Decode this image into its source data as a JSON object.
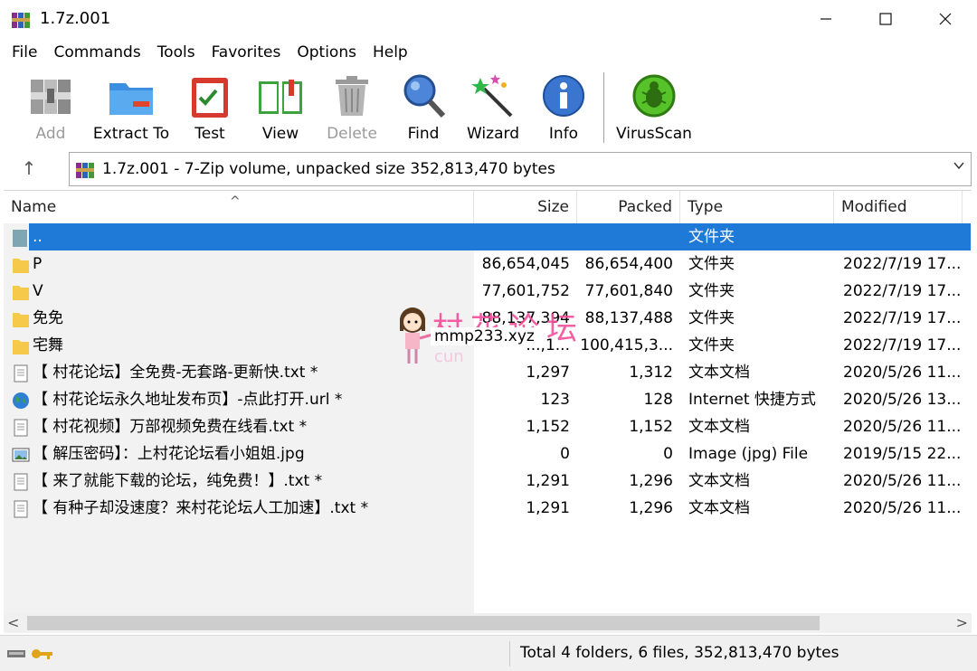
{
  "window": {
    "title": "1.7z.001",
    "minimize": "—",
    "maximize": "☐",
    "close": "✕"
  },
  "menu": [
    "File",
    "Commands",
    "Tools",
    "Favorites",
    "Options",
    "Help"
  ],
  "toolbar": {
    "add": "Add",
    "extract": "Extract To",
    "test": "Test",
    "view": "View",
    "delete": "Delete",
    "find": "Find",
    "wizard": "Wizard",
    "info": "Info",
    "virusscan": "VirusScan"
  },
  "address": {
    "up_arrow": "↑",
    "text": "1.7z.001 - 7-Zip volume, unpacked size 352,813,470 bytes",
    "chevron": "⌵"
  },
  "columns": {
    "name": "Name",
    "size": "Size",
    "packed": "Packed",
    "type": "Type",
    "modified": "Modified",
    "sort_indicator": "^"
  },
  "rows": [
    {
      "name": "..",
      "size": "",
      "packed": "",
      "type": "文件夹",
      "modified": "",
      "icon": "parent-folder-icon",
      "selected": true
    },
    {
      "name": "P",
      "size": "86,654,045",
      "packed": "86,654,400",
      "type": "文件夹",
      "modified": "2022/7/19 17...",
      "icon": "folder-icon"
    },
    {
      "name": "V",
      "size": "77,601,752",
      "packed": "77,601,840",
      "type": "文件夹",
      "modified": "2022/7/19 17...",
      "icon": "folder-icon"
    },
    {
      "name": "免免",
      "size": "88,137,394",
      "packed": "88,137,488",
      "type": "文件夹",
      "modified": "2022/7/19 17...",
      "icon": "folder-icon"
    },
    {
      "name": "宅舞",
      "size": "...,1...",
      "packed": "100,415,3...",
      "type": "文件夹",
      "modified": "2022/7/19 17...",
      "icon": "folder-icon"
    },
    {
      "name": "【 村花论坛】全免费-无套路-更新快.txt *",
      "size": "1,297",
      "packed": "1,312",
      "type": "文本文档",
      "modified": "2020/5/26 11...",
      "icon": "text-file-icon"
    },
    {
      "name": "【 村花论坛永久地址发布页】-点此打开.url *",
      "size": "123",
      "packed": "128",
      "type": "Internet 快捷方式",
      "modified": "2020/5/26 13...",
      "icon": "globe-icon"
    },
    {
      "name": "【 村花视频】万部视频免费在线看.txt *",
      "size": "1,152",
      "packed": "1,152",
      "type": "文本文档",
      "modified": "2020/5/26 11...",
      "icon": "text-file-icon"
    },
    {
      "name": "【 解压密码】：上村花论坛看小姐姐.jpg",
      "size": "0",
      "packed": "0",
      "type": "Image (jpg) File",
      "modified": "2019/5/15 22...",
      "icon": "image-file-icon"
    },
    {
      "name": "【 来了就能下载的论坛，纯免费！】.txt *",
      "size": "1,291",
      "packed": "1,296",
      "type": "文本文档",
      "modified": "2020/5/26 11...",
      "icon": "text-file-icon"
    },
    {
      "name": "【 有种子却没速度？来村花论坛人工加速】.txt *",
      "size": "1,291",
      "packed": "1,296",
      "type": "文本文档",
      "modified": "2020/5/26 11...",
      "icon": "text-file-icon"
    }
  ],
  "scroll": {
    "left": "<",
    "right": ">"
  },
  "status": {
    "text": "Total 4 folders, 6 files, 352,813,470 bytes"
  },
  "watermark": {
    "han": "村花论坛",
    "url": "mmp233.xyz",
    "latin": "cun"
  },
  "colors": {
    "selection": "#1e7ad6",
    "folder": "#f6c94a",
    "watermark_pink": "#f54d9b"
  }
}
